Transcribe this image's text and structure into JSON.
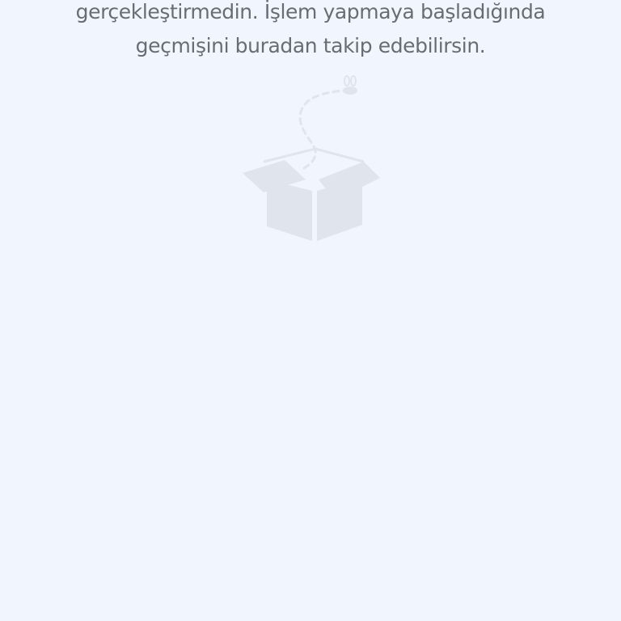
{
  "empty_state": {
    "message_line_1": "gerçekleştirmedin. İşlem yapmaya başladığında",
    "message_line_2": "geçmişini buradan takip edebilirsin.",
    "illustration_icon": "empty-box-with-fly-icon",
    "text_color": "#6a6c73",
    "illustration_color": "#e0e4ec",
    "background_color": "#f1f5fd"
  }
}
